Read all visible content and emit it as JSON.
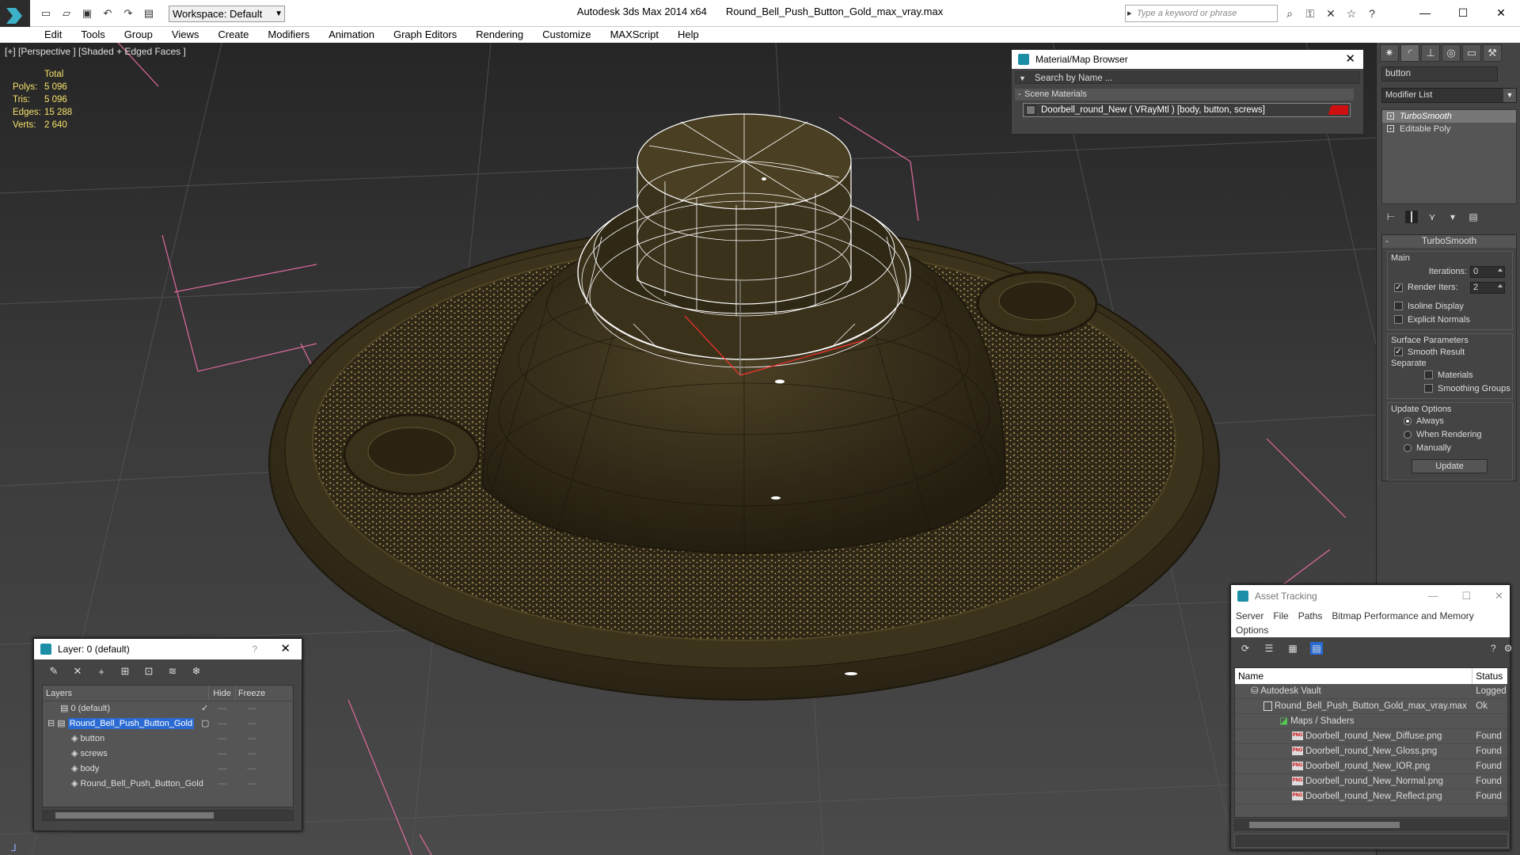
{
  "window": {
    "app_title": "Autodesk 3ds Max  2014 x64",
    "file_title": "Round_Bell_Push_Button_Gold_max_vray.max",
    "workspace": "Workspace: Default",
    "search_placeholder": "Type a keyword or phrase"
  },
  "menu": [
    "Edit",
    "Tools",
    "Group",
    "Views",
    "Create",
    "Modifiers",
    "Animation",
    "Graph Editors",
    "Rendering",
    "Customize",
    "MAXScript",
    "Help"
  ],
  "viewport": {
    "label": "[+] [Perspective ] [Shaded + Edged Faces ]",
    "stats_header": "Total",
    "stats": [
      {
        "label": "Polys:",
        "value": "5 096"
      },
      {
        "label": "Tris:",
        "value": "5 096"
      },
      {
        "label": "Edges:",
        "value": "15 288"
      },
      {
        "label": "Verts:",
        "value": "2 640"
      }
    ]
  },
  "material_browser": {
    "title": "Material/Map Browser",
    "search": "Search by Name ...",
    "group": "Scene Materials",
    "item": "Doorbell_round_New  ( VRayMtl )  [body, button, screws]"
  },
  "command_panel": {
    "object_name": "button",
    "modifier_list": "Modifier List",
    "stack": [
      "TurboSmooth",
      "Editable Poly"
    ],
    "rollout_title": "TurboSmooth",
    "main_label": "Main",
    "iterations_label": "Iterations:",
    "iterations_value": "0",
    "render_iters_label": "Render Iters:",
    "render_iters_value": "2",
    "isoline": "Isoline Display",
    "explicit_normals": "Explicit Normals",
    "surface_label": "Surface Parameters",
    "smooth_result": "Smooth Result",
    "separate_label": "Separate",
    "materials": "Materials",
    "smoothing_groups": "Smoothing Groups",
    "update_options": "Update Options",
    "always": "Always",
    "when_rendering": "When Rendering",
    "manually": "Manually",
    "update_btn": "Update"
  },
  "layers": {
    "title": "Layer: 0 (default)",
    "help": "?",
    "col_layers": "Layers",
    "col_hide": "Hide",
    "col_freeze": "Freeze",
    "rows": [
      {
        "name": "0 (default)",
        "level": 0
      },
      {
        "name": "Round_Bell_Push_Button_Gold",
        "level": 0
      },
      {
        "name": "button",
        "level": 1
      },
      {
        "name": "screws",
        "level": 1
      },
      {
        "name": "body",
        "level": 1
      },
      {
        "name": "Round_Bell_Push_Button_Gold",
        "level": 1
      }
    ]
  },
  "asset_tracking": {
    "title": "Asset Tracking",
    "menu": [
      "Server",
      "File",
      "Paths",
      "Bitmap Performance and Memory"
    ],
    "menu2": "Options",
    "col_name": "Name",
    "col_status": "Status",
    "rows": [
      {
        "name": "Autodesk Vault",
        "status": "Logged",
        "indent": 1,
        "icon": "vault"
      },
      {
        "name": "Round_Bell_Push_Button_Gold_max_vray.max",
        "status": "Ok",
        "indent": 2,
        "icon": "max"
      },
      {
        "name": "Maps / Shaders",
        "status": "",
        "indent": 3,
        "icon": "maps"
      },
      {
        "name": "Doorbell_round_New_Diffuse.png",
        "status": "Found",
        "indent": 4,
        "icon": "png"
      },
      {
        "name": "Doorbell_round_New_Gloss.png",
        "status": "Found",
        "indent": 4,
        "icon": "png"
      },
      {
        "name": "Doorbell_round_New_IOR.png",
        "status": "Found",
        "indent": 4,
        "icon": "png"
      },
      {
        "name": "Doorbell_round_New_Normal.png",
        "status": "Found",
        "indent": 4,
        "icon": "png"
      },
      {
        "name": "Doorbell_round_New_Reflect.png",
        "status": "Found",
        "indent": 4,
        "icon": "png"
      }
    ]
  },
  "colors": {
    "selection": "#2a6bd3",
    "stats": "#f7e36b",
    "gold": "#4a3f20",
    "wire": "#ffffff"
  }
}
